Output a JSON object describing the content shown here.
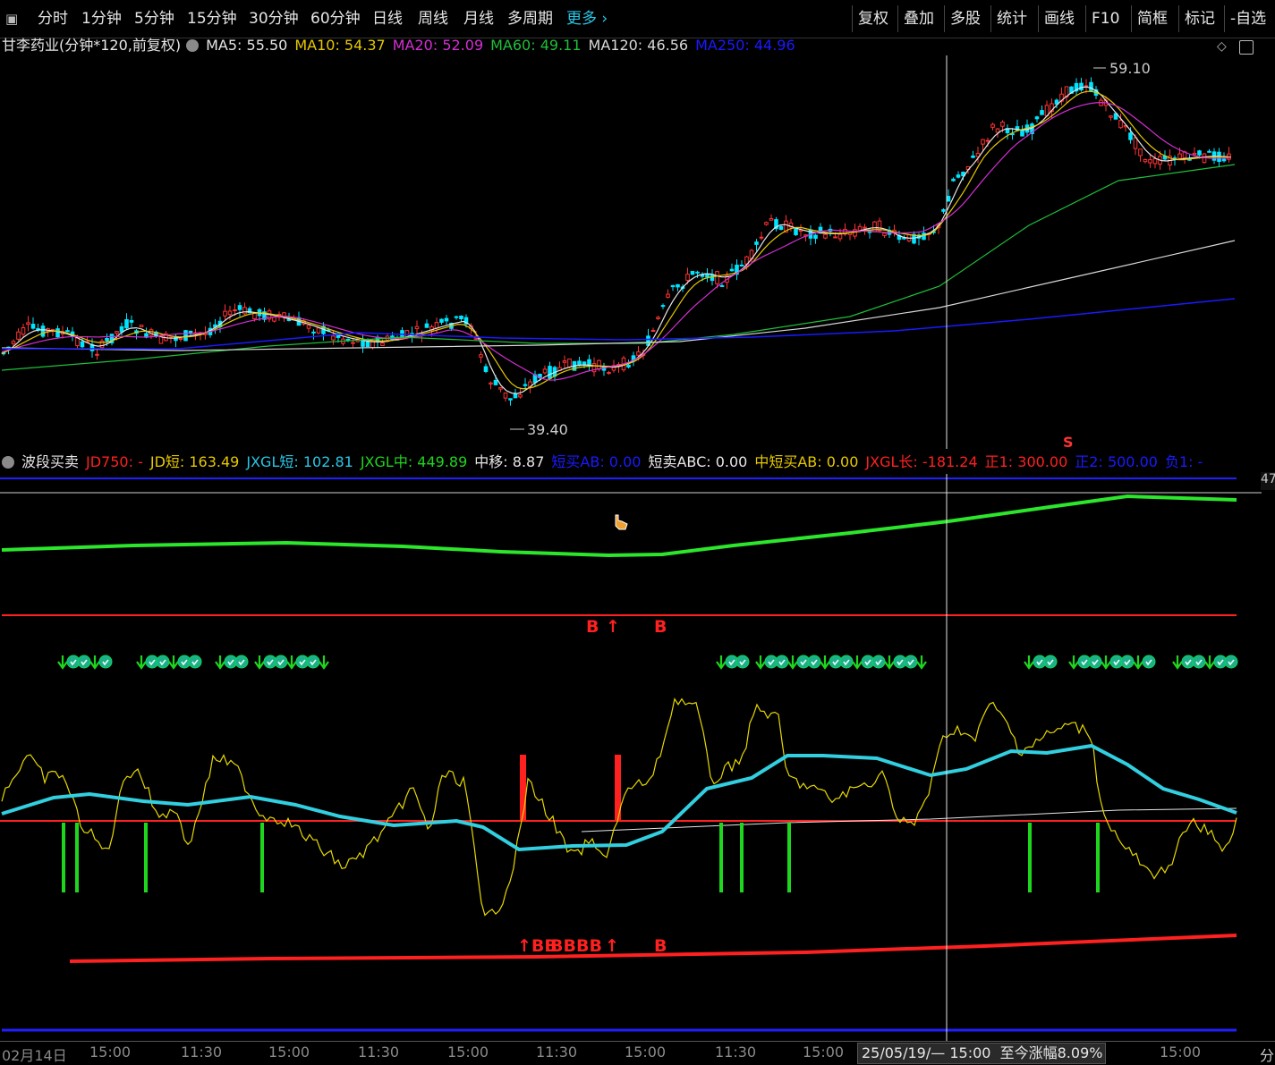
{
  "toolbar": {
    "menu_glyph": "▣",
    "periods": [
      "分时",
      "1分钟",
      "5分钟",
      "15分钟",
      "30分钟",
      "60分钟",
      "日线",
      "周线",
      "月线",
      "多周期"
    ],
    "more": "更多 ›",
    "right_items": [
      "复权",
      "叠加",
      "多股",
      "统计",
      "画线",
      "F10",
      "简框",
      "标记",
      "-自选"
    ]
  },
  "main_chart": {
    "title": "甘李药业(分钟*120,前复权)",
    "ma": [
      {
        "label": "MA5: 55.50",
        "color": "#e6e6e6"
      },
      {
        "label": "MA10: 54.37",
        "color": "#e6c800"
      },
      {
        "label": "MA20: 52.09",
        "color": "#d42fd4"
      },
      {
        "label": "MA60: 49.11",
        "color": "#1fbf3a"
      },
      {
        "label": "MA120: 46.56",
        "color": "#d8d8d8"
      },
      {
        "label": "MA250: 44.96",
        "color": "#1a1aff"
      }
    ],
    "high_label": "59.10",
    "low_label": "39.40",
    "signal_s": "S"
  },
  "indicator": {
    "title": "波段买卖",
    "values": [
      {
        "label": "JD750: -",
        "color": "#ff2020"
      },
      {
        "label": "JD短: 163.49",
        "color": "#e6c800"
      },
      {
        "label": "JXGL短: 102.81",
        "color": "#29c6e6"
      },
      {
        "label": "JXGL中: 449.89",
        "color": "#1fd61f"
      },
      {
        "label": "中移: 8.87",
        "color": "#e6e6e6"
      },
      {
        "label": "短买AB: 0.00",
        "color": "#1a1aff"
      },
      {
        "label": "短卖ABC: 0.00",
        "color": "#e6e6e6"
      },
      {
        "label": "中短买AB: 0.00",
        "color": "#e6c800"
      },
      {
        "label": "JXGL长: -181.24",
        "color": "#ff2020"
      },
      {
        "label": "正1: 300.00",
        "color": "#ff2020"
      },
      {
        "label": "正2: 500.00",
        "color": "#1a1aff"
      },
      {
        "label": "负1: -",
        "color": "#1a1aff"
      }
    ],
    "side_value": "47",
    "b_labels_upper": [
      "B",
      "↑",
      "B"
    ],
    "b_labels_lower": [
      "↑BB",
      "BBBB",
      "↑",
      "B"
    ]
  },
  "xaxis": {
    "ticks": [
      "02月14日",
      "15:00",
      "11:30",
      "15:00",
      "11:30",
      "15:00",
      "11:30",
      "15:00",
      "11:30",
      "15:00",
      "15:00",
      "分"
    ],
    "cursor_label": "25/05/19/— 15:00",
    "gain_label": "至今涨幅8.09%"
  },
  "colors": {
    "up": "#ff3333",
    "down": "#00e5ff",
    "ma5": "#e6e6e6",
    "ma10": "#e6c800",
    "ma20": "#d42fd4",
    "ma60": "#1fbf3a",
    "ma120": "#d8d8d8",
    "ma250": "#1a1aff"
  }
}
